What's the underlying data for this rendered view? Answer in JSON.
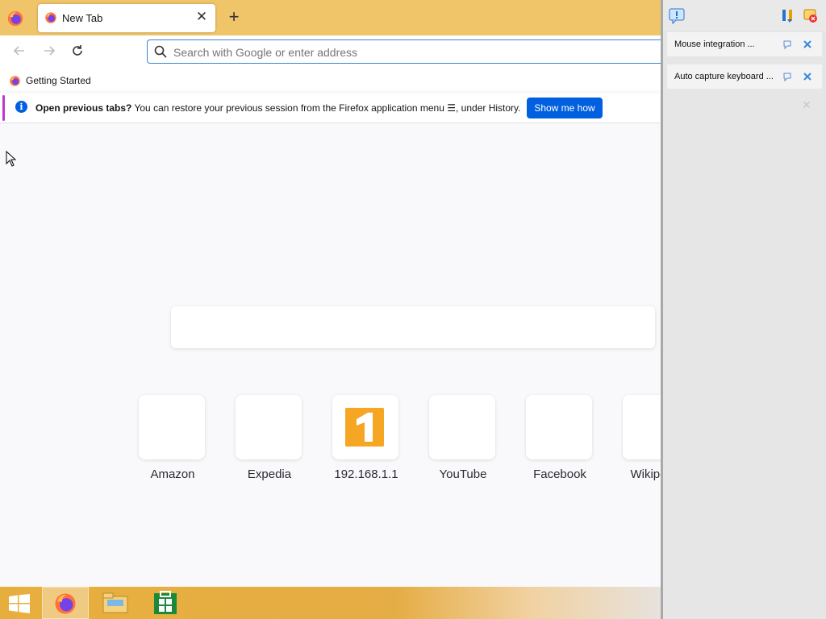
{
  "browser": {
    "tab": {
      "title": "New Tab"
    },
    "urlbar": {
      "placeholder": "Search with Google or enter address"
    },
    "bookmarks": [
      {
        "label": "Getting Started"
      }
    ],
    "notification": {
      "bold": "Open previous tabs?",
      "text": "You can restore your previous session from the Firefox application menu ☰, under History.",
      "button": "Show me how"
    },
    "top_sites": [
      {
        "label": "Amazon"
      },
      {
        "label": "Expedia"
      },
      {
        "label": "192.168.1.1"
      },
      {
        "label": "YouTube"
      },
      {
        "label": "Facebook"
      },
      {
        "label": "Wikipedia"
      }
    ]
  },
  "side_panel": {
    "rows": [
      {
        "label": "Mouse integration ..."
      },
      {
        "label": "Auto capture keyboard ..."
      }
    ]
  },
  "colors": {
    "tabstrip": "#f0c56a",
    "accent": "#0060df",
    "taskbar": "#e8ae3d"
  },
  "icons": [
    "firefox-icon",
    "close-icon",
    "plus-icon",
    "back-icon",
    "forward-icon",
    "reload-icon",
    "search-icon",
    "info-icon",
    "windows-start-icon",
    "file-explorer-icon",
    "store-icon"
  ]
}
